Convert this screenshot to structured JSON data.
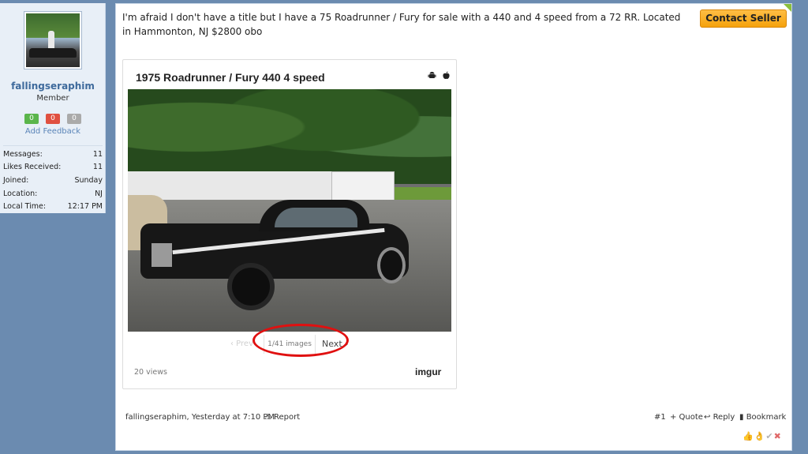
{
  "user": {
    "name": "fallingseraphim",
    "title": "Member",
    "feedback": {
      "positive": "0",
      "negative": "0",
      "neutral": "0",
      "add_label": "Add Feedback"
    },
    "stats": [
      {
        "label": "Messages:",
        "value": "11"
      },
      {
        "label": "Likes Received:",
        "value": "11"
      },
      {
        "label": "Joined:",
        "value": "Sunday"
      },
      {
        "label": "Location:",
        "value": "NJ"
      },
      {
        "label": "Local Time:",
        "value": "12:17 PM"
      }
    ]
  },
  "post": {
    "text": "I'm afraid I don't have a title but I have a 75 Roadrunner / Fury for sale with a 440 and 4 speed from a 72 RR. Located in Hammonton, NJ $2800 obo",
    "contact_label": "Contact Seller",
    "embed": {
      "title": "1975 Roadrunner / Fury 440 4 speed",
      "prev_label": "‹ Prev",
      "count_label": "1/41 images",
      "next_label": "Next ›",
      "views_label": "20 views",
      "brand": "imgur"
    },
    "footer": {
      "author_meta": "fallingseraphim, Yesterday at 7:10 PM",
      "report_label": "Report",
      "post_number": "#1",
      "quote_label": "+ Quote",
      "reply_label": "Reply",
      "bookmark_label": "Bookmark"
    }
  },
  "colors": {
    "page_bg": "#6b8bb0",
    "accent_button": "#f5a20c",
    "highlight_ring": "#e01010"
  }
}
